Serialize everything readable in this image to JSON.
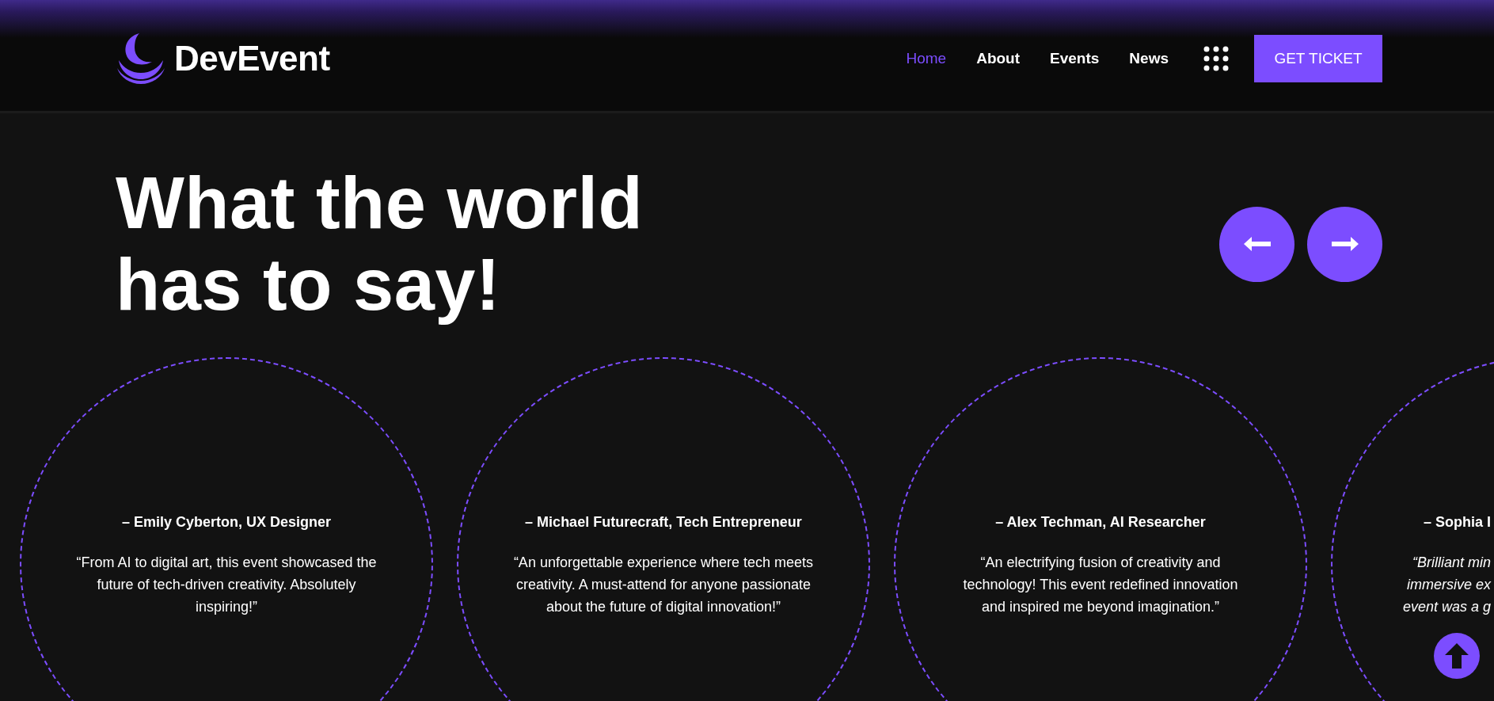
{
  "header": {
    "logo_text": "DevEvent",
    "nav": [
      {
        "label": "Home",
        "selected": true
      },
      {
        "label": "About",
        "selected": false
      },
      {
        "label": "Events",
        "selected": false
      },
      {
        "label": "News",
        "selected": false
      }
    ],
    "cta": "GET TICKET"
  },
  "hero": {
    "title_lines": [
      "What the world",
      "has to say!"
    ]
  },
  "testimonials": [
    {
      "author": "– Emily Cyberton, UX Designer",
      "italic": false,
      "quote_lines": [
        "“From AI to digital art, this event showcased the",
        "future of tech-driven creativity. Absolutely",
        "inspiring!”"
      ]
    },
    {
      "author": "– Michael Futurecraft, Tech Entrepreneur",
      "italic": false,
      "quote_lines": [
        "“An unforgettable experience where tech meets",
        "creativity. A must-attend for anyone passionate",
        "about the future of digital innovation!”"
      ]
    },
    {
      "author": "– Alex Techman, AI Researcher",
      "italic": false,
      "quote_lines": [
        "“An electrifying fusion of creativity and",
        "technology! This event redefined innovation",
        "and inspired me beyond imagination.”"
      ]
    },
    {
      "author": "– Sophia I",
      "italic": true,
      "quote_lines": [
        "“Brilliant min",
        "immersive ex",
        "event was a g"
      ]
    }
  ]
}
